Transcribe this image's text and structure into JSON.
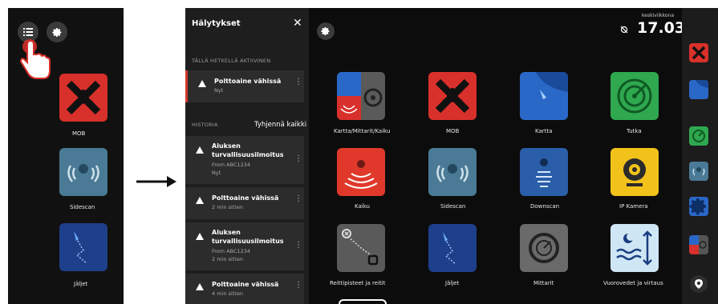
{
  "left_screen": {
    "tiles": [
      {
        "label": "MOB",
        "icon": "mob-icon",
        "color": "#d8302b"
      },
      {
        "label": "Sidescan",
        "icon": "sidescan-icon",
        "color": "#4a7a96"
      },
      {
        "label": "Jäljet",
        "icon": "tracks-icon",
        "color": "#1e3f8a"
      }
    ]
  },
  "alerts_panel": {
    "title": "Hälytykset",
    "close_glyph": "✕",
    "active_header": "TÄLLÄ HETKELLÄ AKTIIVINEN",
    "history_header": "HISTORIA",
    "clear_all": "Tyhjennä kaikki",
    "active": [
      {
        "title": "Polttoaine vähissä",
        "time": "Nyt"
      }
    ],
    "history": [
      {
        "title_line1": "Aluksen",
        "title_line2": "turvallisuusilmoitus",
        "source": "From ABC1234",
        "time": "Nyt"
      },
      {
        "title": "Polttoaine vähissä",
        "time": "2 min sitten"
      },
      {
        "title_line1": "Aluksen",
        "title_line2": "turvallisuusilmoitus",
        "source": "From ABC1234",
        "time": "2 min sitten"
      },
      {
        "title": "Polttoaine vähissä",
        "time": "4 min sitten"
      }
    ]
  },
  "status": {
    "day": "keskiviikkona",
    "time": "17.03"
  },
  "apps": [
    {
      "label": "Kartta/Mittarit/Kaiku",
      "icon": "chart-gauges-sonar-icon"
    },
    {
      "label": "MOB",
      "icon": "mob-icon"
    },
    {
      "label": "Kartta",
      "icon": "chart-icon"
    },
    {
      "label": "Tutka",
      "icon": "radar-icon"
    },
    {
      "label": "Kaiku",
      "icon": "echo-icon"
    },
    {
      "label": "Sidescan",
      "icon": "sidescan-icon"
    },
    {
      "label": "Downscan",
      "icon": "downscan-icon"
    },
    {
      "label": "IP Kamera",
      "icon": "ip-camera-icon"
    },
    {
      "label": "Reittipisteet ja reitit",
      "icon": "waypoints-routes-icon"
    },
    {
      "label": "Jäljet",
      "icon": "tracks-icon"
    },
    {
      "label": "Mittarit",
      "icon": "gauges-icon"
    },
    {
      "label": "Vuorovedet ja virtaus",
      "icon": "tides-currents-icon"
    }
  ],
  "colors": {
    "mob_red": "#d8302b",
    "chart_blue": "#2a68c8",
    "radar_green": "#2fa84f",
    "echo_red": "#e0392b",
    "sidescan_blue": "#4a7a96",
    "downscan_blue": "#2a5ea8",
    "camera_yellow": "#f2c21b",
    "waypoint_gray": "#5a5a5a",
    "tracks_blue": "#1e3f8a",
    "gauges_gray": "#6a6a6a",
    "tides_light": "#cfe6f5"
  }
}
